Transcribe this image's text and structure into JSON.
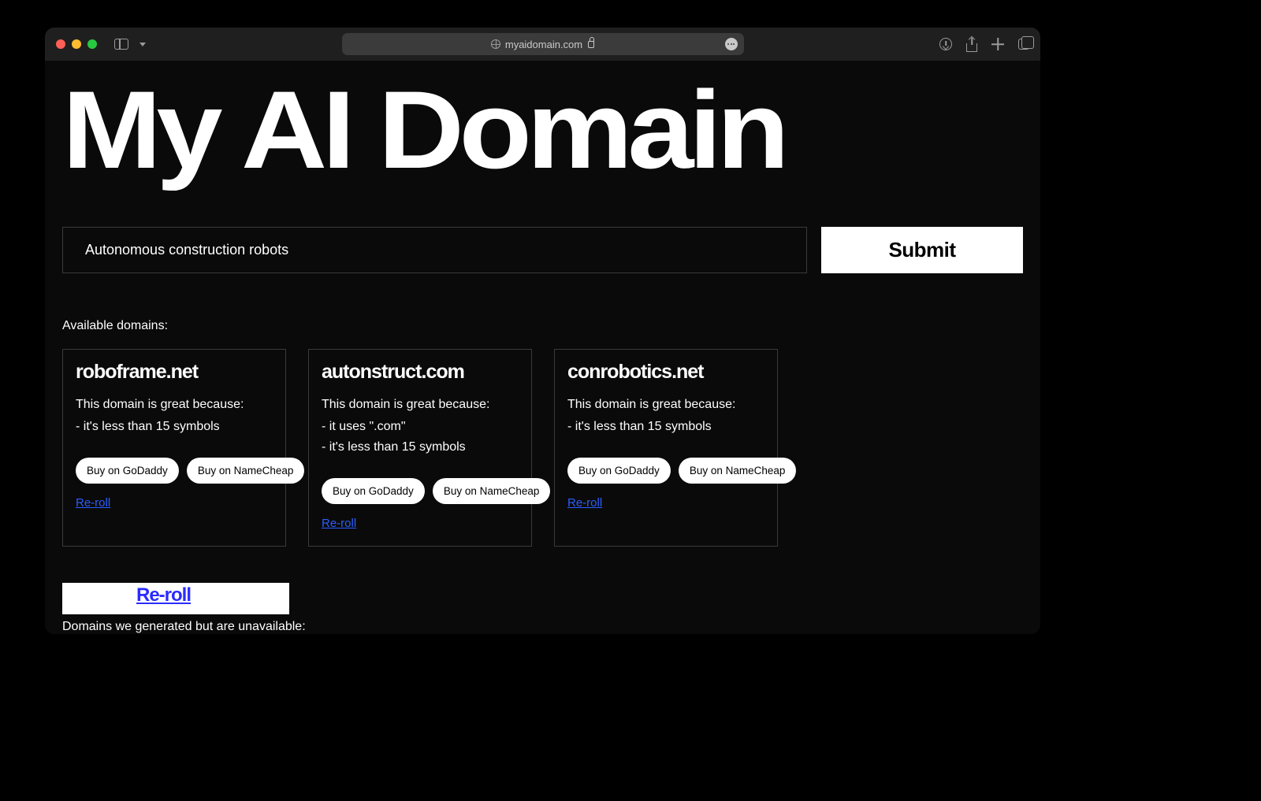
{
  "browser": {
    "url": "myaidomain.com"
  },
  "page": {
    "title": "My AI Domain",
    "search_value": "Autonomous construction robots",
    "submit_label": "Submit",
    "available_label": "Available domains:",
    "unavailable_label": "Domains we generated but are unavailable:",
    "big_reroll_label": "Re-roll"
  },
  "labels": {
    "reason_intro": "This domain is great because:",
    "buy_godaddy": "Buy on GoDaddy",
    "buy_namecheap": "Buy on NameCheap",
    "reroll": "Re-roll"
  },
  "cards": [
    {
      "domain": "roboframe.net",
      "reasons": [
        "- it's less than 15 symbols"
      ]
    },
    {
      "domain": "autonstruct.com",
      "reasons": [
        "- it uses \".com\"",
        "- it's less than 15 symbols"
      ]
    },
    {
      "domain": "conrobotics.net",
      "reasons": [
        "- it's less than 15 symbols"
      ]
    }
  ]
}
